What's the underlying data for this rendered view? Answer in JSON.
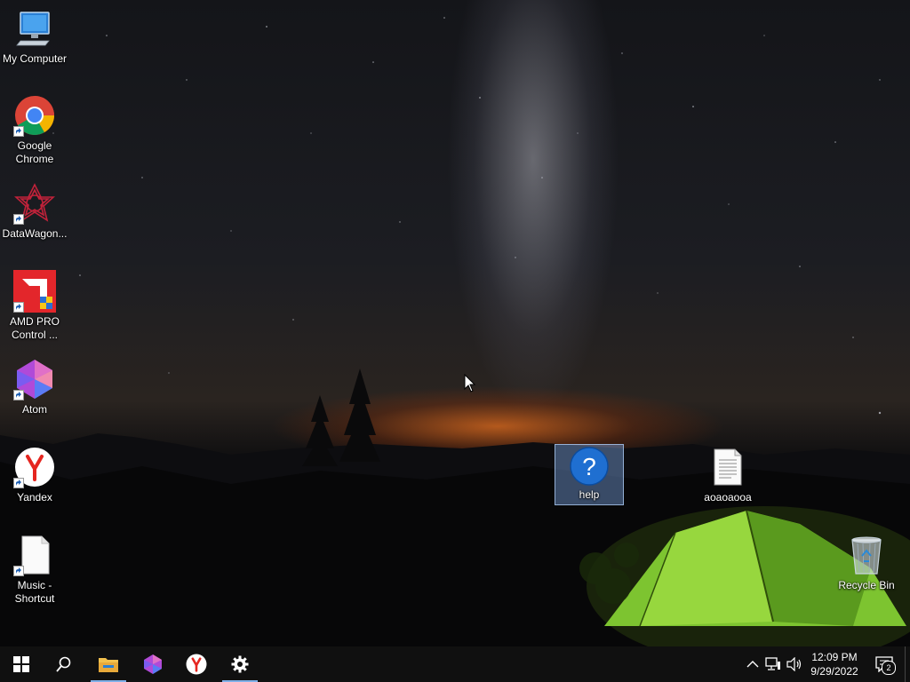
{
  "desktop": {
    "icons": [
      {
        "label": "My Computer",
        "icon": "computer-icon"
      },
      {
        "label": "Google Chrome",
        "icon": "chrome-icon"
      },
      {
        "label": "DataWagon...",
        "icon": "datawagon-icon"
      },
      {
        "label": "AMD PRO Control ...",
        "icon": "amd-icon"
      },
      {
        "label": "Atom",
        "icon": "atom-icon"
      },
      {
        "label": "Yandex",
        "icon": "yandex-icon"
      },
      {
        "label": "Music - Shortcut",
        "icon": "file-icon"
      },
      {
        "label": "help",
        "icon": "help-icon",
        "selected": true
      },
      {
        "label": "aoaoaooa",
        "icon": "text-file-icon"
      },
      {
        "label": "Recycle Bin",
        "icon": "recycle-bin-icon"
      }
    ]
  },
  "taskbar": {
    "buttons": [
      "start-icon",
      "search-icon",
      "file-explorer-icon",
      "atom-icon",
      "yandex-icon",
      "settings-icon"
    ],
    "tray": {
      "time": "12:09 PM",
      "date": "9/29/2022",
      "notification_count": "2"
    }
  },
  "colors": {
    "taskbar": "#101010",
    "accent": "#7fb0e8",
    "selection": "#78a0dc"
  }
}
